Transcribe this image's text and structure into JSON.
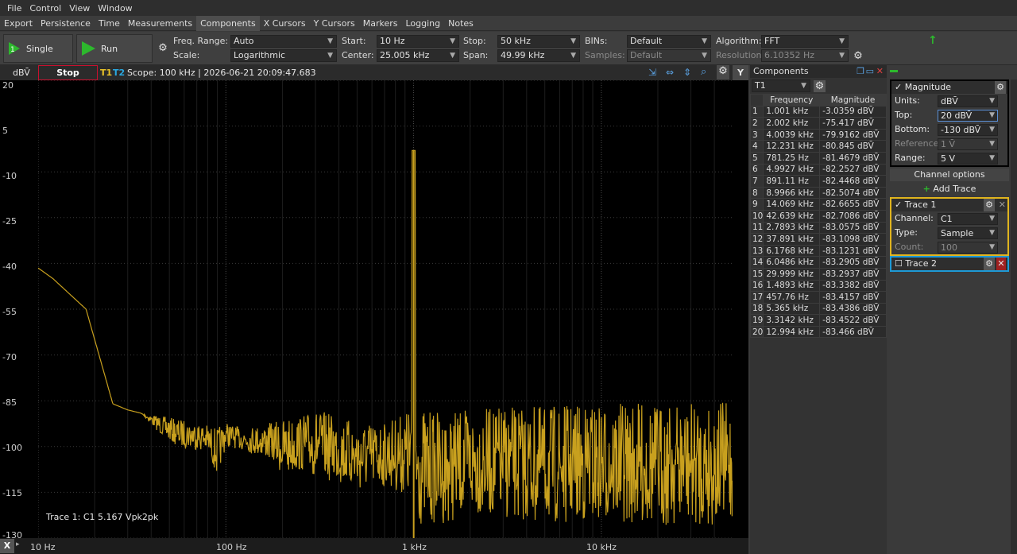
{
  "menu": [
    "File",
    "Control",
    "View",
    "Window"
  ],
  "tabs": [
    "Export",
    "Persistence",
    "Time",
    "Measurements",
    "Components",
    "X Cursors",
    "Y Cursors",
    "Markers",
    "Logging",
    "Notes"
  ],
  "active_tab": "Components",
  "toolbar": {
    "single_label": "Single",
    "run_label": "Run",
    "freq_range_label": "Freq. Range:",
    "freq_range_value": "Auto",
    "scale_label": "Scale:",
    "scale_value": "Logarithmic",
    "start_label": "Start:",
    "start_value": "10 Hz",
    "center_label": "Center:",
    "center_value": "25.005 kHz",
    "stop_label": "Stop:",
    "stop_value": "50 kHz",
    "span_label": "Span:",
    "span_value": "49.99 kHz",
    "bins_label": "BINs:",
    "bins_value": "Default",
    "samples_label": "Samples:",
    "samples_value": "Default",
    "algorithm_label": "Algorithm:",
    "algorithm_value": "FFT",
    "resolution_label": "Resolution:",
    "resolution_value": "6.10352 Hz"
  },
  "scope": {
    "unit": "dBV̄",
    "stop_label": "Stop",
    "t1": "T1",
    "t2": "T2",
    "info": "Scope: 100 kHz | 2026-06-21 20:09:47.683",
    "trace_note": "Trace 1: C1 5.167 Vpk2pk",
    "x_button": "X"
  },
  "chart_data": {
    "type": "line",
    "title": "",
    "xlabel": "",
    "ylabel": "dBV̄",
    "xscale": "log",
    "xlim": [
      10,
      50000
    ],
    "ylim": [
      -130,
      20
    ],
    "yticks": [
      "20",
      "5",
      "-10",
      "-25",
      "-40",
      "-55",
      "-70",
      "-85",
      "-100",
      "-115",
      "-130"
    ],
    "xticks": [
      "10 Hz",
      "100 Hz",
      "1 kHz",
      "10 kHz"
    ],
    "grid": true,
    "series": [
      {
        "color": "#c8a01e",
        "envelope_x": [
          10,
          12,
          18,
          25,
          30,
          35,
          45,
          55,
          70,
          80,
          90,
          100,
          120,
          150,
          180,
          200,
          250,
          300,
          400,
          500,
          700,
          900,
          980,
          1001,
          1020,
          1100,
          1500,
          2000,
          3000,
          5000,
          8000,
          12000,
          20000,
          30000,
          50000
        ],
        "envelope_top": [
          -41.5,
          -45,
          -55,
          -86,
          -88,
          -89,
          -90,
          -91,
          -92,
          -93,
          -94,
          -92,
          -94,
          -93,
          -92,
          -91,
          -90,
          -88,
          -90,
          -92,
          -92,
          -89,
          -85,
          -3.0,
          -85,
          -88,
          -89,
          -88,
          -87,
          -87,
          -86,
          -86,
          -86,
          -86,
          -85
        ],
        "envelope_bottom": [
          -41.5,
          -45,
          -55,
          -86,
          -88,
          -89,
          -96,
          -100,
          -101,
          -102,
          -110,
          -100,
          -101,
          -103,
          -105,
          -110,
          -108,
          -110,
          -112,
          -115,
          -113,
          -116,
          -120,
          -3.0,
          -125,
          -126,
          -125,
          -122,
          -124,
          -126,
          -125,
          -125,
          -126,
          -126,
          -126
        ]
      }
    ]
  },
  "components": {
    "title": "Components",
    "selector": "T1",
    "col_freq": "Frequency",
    "col_mag": "Magnitude",
    "rows": [
      [
        "1",
        "1.001 kHz",
        "-3.0359 dBV̄"
      ],
      [
        "2",
        "2.002 kHz",
        "-75.417 dBV̄"
      ],
      [
        "3",
        "4.0039 kHz",
        "-79.9162 dBV̄"
      ],
      [
        "4",
        "12.231 kHz",
        "-80.845 dBV̄"
      ],
      [
        "5",
        "781.25 Hz",
        "-81.4679 dBV̄"
      ],
      [
        "6",
        "4.9927 kHz",
        "-82.2527 dBV̄"
      ],
      [
        "7",
        "891.11 Hz",
        "-82.4468 dBV̄"
      ],
      [
        "8",
        "8.9966 kHz",
        "-82.5074 dBV̄"
      ],
      [
        "9",
        "14.069 kHz",
        "-82.6655 dBV̄"
      ],
      [
        "10",
        "42.639 kHz",
        "-82.7086 dBV̄"
      ],
      [
        "11",
        "2.7893 kHz",
        "-83.0575 dBV̄"
      ],
      [
        "12",
        "37.891 kHz",
        "-83.1098 dBV̄"
      ],
      [
        "13",
        "6.1768 kHz",
        "-83.1231 dBV̄"
      ],
      [
        "14",
        "6.0486 kHz",
        "-83.2905 dBV̄"
      ],
      [
        "15",
        "29.999 kHz",
        "-83.2937 dBV̄"
      ],
      [
        "16",
        "1.4893 kHz",
        "-83.3382 dBV̄"
      ],
      [
        "17",
        "457.76 Hz",
        "-83.4157 dBV̄"
      ],
      [
        "18",
        "5.365 kHz",
        "-83.4386 dBV̄"
      ],
      [
        "19",
        "3.3142 kHz",
        "-83.4522 dBV̄"
      ],
      [
        "20",
        "12.994 kHz",
        "-83.466 dBV̄"
      ]
    ]
  },
  "side_tab": "Y",
  "magnitude": {
    "title": "Magnitude",
    "units_label": "Units:",
    "units_value": "dBV̄",
    "top_label": "Top:",
    "top_value": "20 dBV̄",
    "bottom_label": "Bottom:",
    "bottom_value": "-130 dBV̄",
    "reference_label": "Reference:",
    "reference_value": "1 V̄",
    "range_label": "Range:",
    "range_value": "5 V"
  },
  "channel_options_label": "Channel options",
  "add_trace_label": "Add Trace",
  "trace1": {
    "title": "Trace 1",
    "channel_label": "Channel:",
    "channel_value": "C1",
    "type_label": "Type:",
    "type_value": "Sample",
    "count_label": "Count:",
    "count_value": "100"
  },
  "trace2": {
    "title": "Trace 2"
  },
  "colors": {
    "accent_trace": "#c8a01e",
    "stop_border": "#c8102e",
    "trace1_border": "#e0b41e",
    "trace2_border": "#1e9ad6",
    "run_green": "#2db82d"
  }
}
